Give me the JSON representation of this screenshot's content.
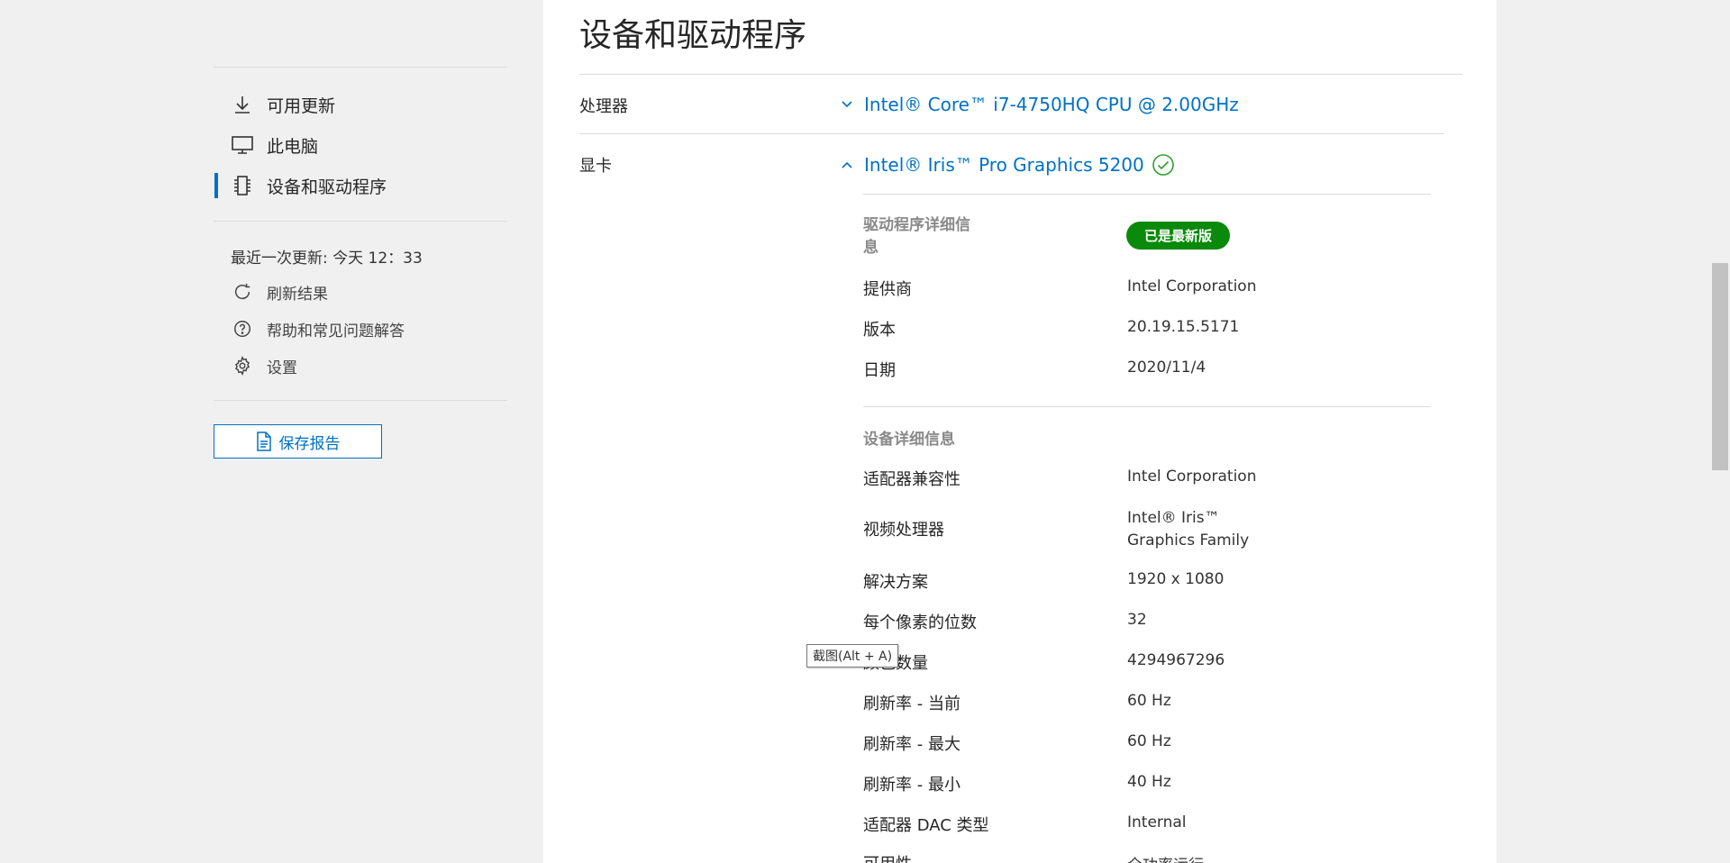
{
  "sidebar": {
    "nav": [
      {
        "label": "可用更新",
        "icon": "download-icon"
      },
      {
        "label": "此电脑",
        "icon": "monitor-icon"
      },
      {
        "label": "设备和驱动程序",
        "icon": "chip-icon"
      }
    ],
    "last_update": "最近一次更新: 今天 12：33",
    "links": [
      {
        "label": "刷新结果",
        "icon": "refresh-icon"
      },
      {
        "label": "帮助和常见问题解答",
        "icon": "help-icon"
      },
      {
        "label": "设置",
        "icon": "gear-icon"
      }
    ],
    "save_report": "保存报告"
  },
  "main": {
    "title": "设备和驱动程序",
    "processor": {
      "label": "处理器",
      "device": "Intel® Core™ i7-4750HQ CPU @ 2.00GHz"
    },
    "gpu": {
      "label": "显卡",
      "device": "Intel® Iris™ Pro Graphics 5200"
    },
    "driver_section": "驱动程序详细信息",
    "status_badge": "已是最新版",
    "driver_rows": [
      {
        "label": "提供商",
        "value": "Intel Corporation"
      },
      {
        "label": "版本",
        "value": "20.19.15.5171"
      },
      {
        "label": "日期",
        "value": "2020/11/4"
      }
    ],
    "device_section": "设备详细信息",
    "device_rows": [
      {
        "label": "适配器兼容性",
        "value": "Intel Corporation"
      },
      {
        "label": "视频处理器",
        "value": "Intel® Iris™ Graphics Family"
      },
      {
        "label": "解决方案",
        "value": "1920 x 1080"
      },
      {
        "label": "每个像素的位数",
        "value": "32"
      },
      {
        "label": "颜色数量",
        "value": "4294967296"
      },
      {
        "label": "刷新率 - 当前",
        "value": "60 Hz"
      },
      {
        "label": "刷新率 - 最大",
        "value": "60 Hz"
      },
      {
        "label": "刷新率 - 最小",
        "value": "40 Hz"
      },
      {
        "label": "适配器 DAC 类型",
        "value": "Internal"
      },
      {
        "label": "可用性",
        "value": "全功率运行"
      }
    ]
  },
  "tooltip": "截图(Alt + A)",
  "colors": {
    "accent": "#0071c5",
    "success": "#0a8a0a"
  }
}
